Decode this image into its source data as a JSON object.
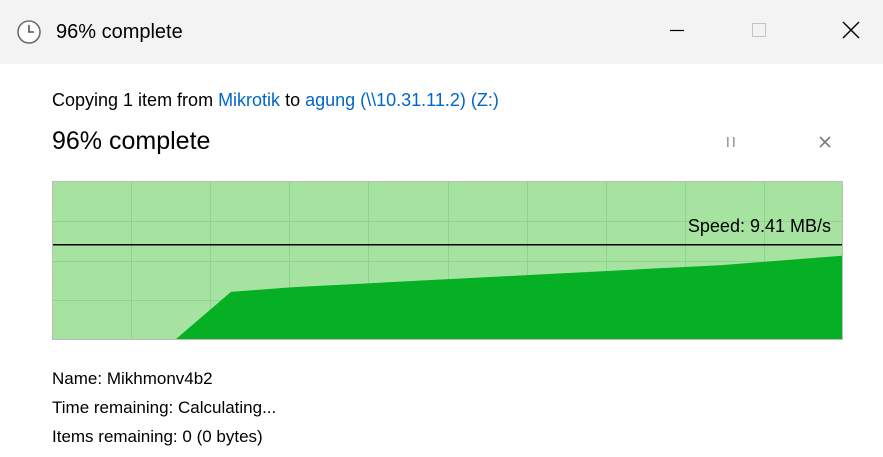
{
  "window": {
    "title": "96% complete",
    "icon": "clock-icon",
    "controls": [
      "minimize-icon",
      "maximize-icon",
      "close-icon"
    ]
  },
  "copy": {
    "prefix": "Copying 1 item from ",
    "source": "Mikrotik",
    "middle": " to ",
    "destination": "agung (\\\\10.31.11.2) (Z:)"
  },
  "progress": {
    "title": "96% complete",
    "percent": 96,
    "pause_icon": "pause-icon",
    "cancel_icon": "close-icon"
  },
  "graph": {
    "speed_label": "Speed: 9.41 MB/s",
    "current_speed_level": 0.6,
    "colors": {
      "background": "#a6e3a1",
      "grid": "#8fd48a",
      "fill": "#06b025",
      "border": "#bcbcbc",
      "speed_line": "#000000"
    },
    "speed_history": [
      0.0,
      0.3,
      0.33,
      0.35,
      0.37,
      0.39,
      0.41,
      0.43,
      0.45,
      0.47,
      0.5,
      0.53
    ]
  },
  "details": {
    "name_label": "Name:",
    "name_value": "Mikhmonv4b2",
    "time_label": "Time remaining:",
    "time_value": "Calculating...",
    "items_label": "Items remaining:",
    "items_value": "0 (0 bytes)"
  }
}
